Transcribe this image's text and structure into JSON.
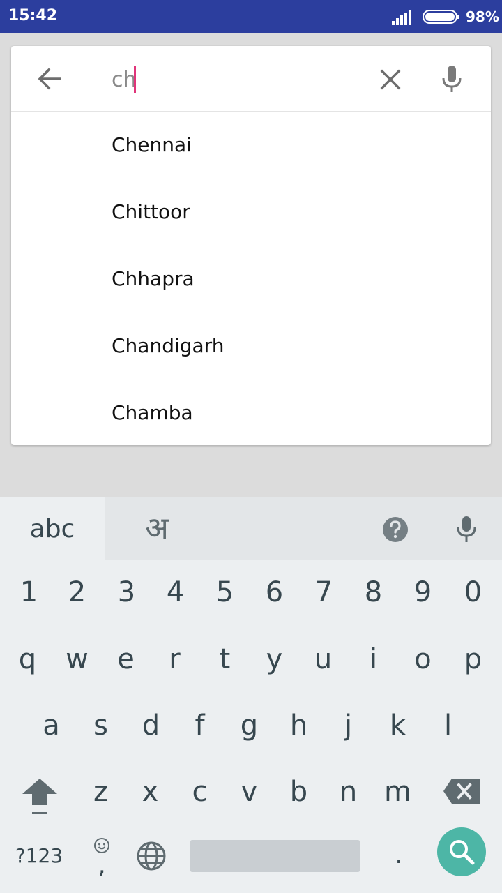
{
  "status_bar": {
    "time": "15:42",
    "battery_pct": "98%",
    "background_color": "#2c3e9e"
  },
  "search": {
    "query": "ch",
    "back_icon": "arrow-left-icon",
    "clear_icon": "close-icon",
    "mic_icon": "mic-icon",
    "caret_color": "#e0357a"
  },
  "suggestions": [
    {
      "label": "Chennai"
    },
    {
      "label": "Chittoor"
    },
    {
      "label": "Chhapra"
    },
    {
      "label": "Chandigarh"
    },
    {
      "label": "Chamba"
    }
  ],
  "keyboard": {
    "lang_abc": "abc",
    "lang_hindi": "अ",
    "help_icon": "help-icon",
    "mic_icon": "mic-icon",
    "digits": [
      "1",
      "2",
      "3",
      "4",
      "5",
      "6",
      "7",
      "8",
      "9",
      "0"
    ],
    "row_q": [
      "q",
      "w",
      "e",
      "r",
      "t",
      "y",
      "u",
      "i",
      "o",
      "p"
    ],
    "row_a": [
      "a",
      "s",
      "d",
      "f",
      "g",
      "h",
      "j",
      "k",
      "l"
    ],
    "row_z": [
      "z",
      "x",
      "c",
      "v",
      "b",
      "n",
      "m"
    ],
    "symbols_label": "?123",
    "comma_label": ",",
    "period_label": ".",
    "search_key_color": "#4db6a6"
  }
}
